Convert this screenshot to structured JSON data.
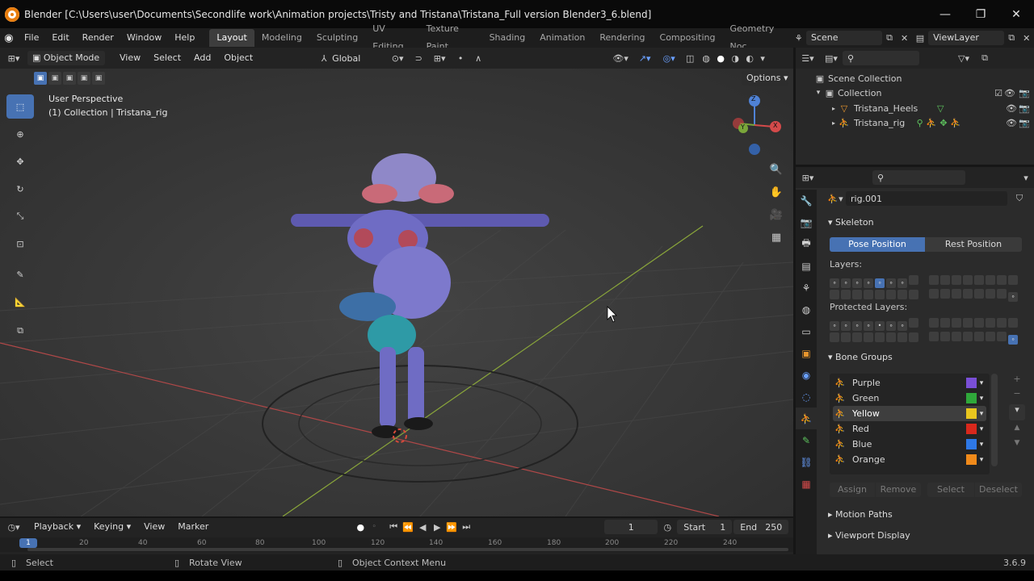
{
  "window": {
    "title": "Blender [C:\\Users\\user\\Documents\\Secondlife work\\Animation projects\\Tristy and Tristana\\Tristana_Full version Blender3_6.blend]",
    "minimize": "—",
    "maximize": "❐",
    "close": "✕"
  },
  "menu": {
    "items": [
      "File",
      "Edit",
      "Render",
      "Window",
      "Help"
    ],
    "workspaces": [
      "Layout",
      "Modeling",
      "Sculpting",
      "UV Editing",
      "Texture Paint",
      "Shading",
      "Animation",
      "Rendering",
      "Compositing",
      "Geometry Noc"
    ],
    "active_workspace": "Layout",
    "scene": "Scene",
    "view_layer": "ViewLayer"
  },
  "viewport_header": {
    "mode": "Object Mode",
    "menus": [
      "View",
      "Select",
      "Add",
      "Object"
    ],
    "transform_orientation": "Global",
    "options": "Options"
  },
  "viewport": {
    "perspective": "User Perspective",
    "collection_line": "(1) Collection | Tristana_rig",
    "gizmo_axes": {
      "x": "X",
      "y": "Y",
      "z": "Z"
    }
  },
  "outliner": {
    "scene_collection": "Scene Collection",
    "collection": "Collection",
    "items": [
      "Tristana_Heels",
      "Tristana_rig"
    ]
  },
  "properties": {
    "object_name": "rig.001",
    "skeleton_title": "Skeleton",
    "pose_position": "Pose Position",
    "rest_position": "Rest Position",
    "layers_label": "Layers:",
    "protected_layers_label": "Protected Layers:",
    "bone_groups_title": "Bone Groups",
    "bone_groups": [
      {
        "name": "Purple",
        "color": "#7a4fd6"
      },
      {
        "name": "Green",
        "color": "#2fa83a"
      },
      {
        "name": "Yellow",
        "color": "#e8c51e"
      },
      {
        "name": "Red",
        "color": "#d8281c"
      },
      {
        "name": "Blue",
        "color": "#2e78e6"
      },
      {
        "name": "Orange",
        "color": "#f08a1a"
      }
    ],
    "selected_bone_group": "Yellow",
    "bone_group_actions": [
      "Assign",
      "Remove",
      "Select",
      "Deselect"
    ],
    "motion_paths": "Motion Paths",
    "viewport_display": "Viewport Display"
  },
  "timeline": {
    "menus": [
      "Playback",
      "Keying",
      "View",
      "Marker"
    ],
    "current_frame": "1",
    "start_label": "Start",
    "start_value": "1",
    "end_label": "End",
    "end_value": "250",
    "ruler_ticks": [
      "1",
      "20",
      "40",
      "60",
      "80",
      "100",
      "120",
      "140",
      "160",
      "180",
      "200",
      "220",
      "240"
    ]
  },
  "statusbar": {
    "select": "Select",
    "rotate_view": "Rotate View",
    "context_menu": "Object Context Menu",
    "version": "3.6.9"
  },
  "colors": {
    "accent": "#4772b3",
    "viewport_bg": "#393939",
    "brand": "#e87d0d"
  }
}
